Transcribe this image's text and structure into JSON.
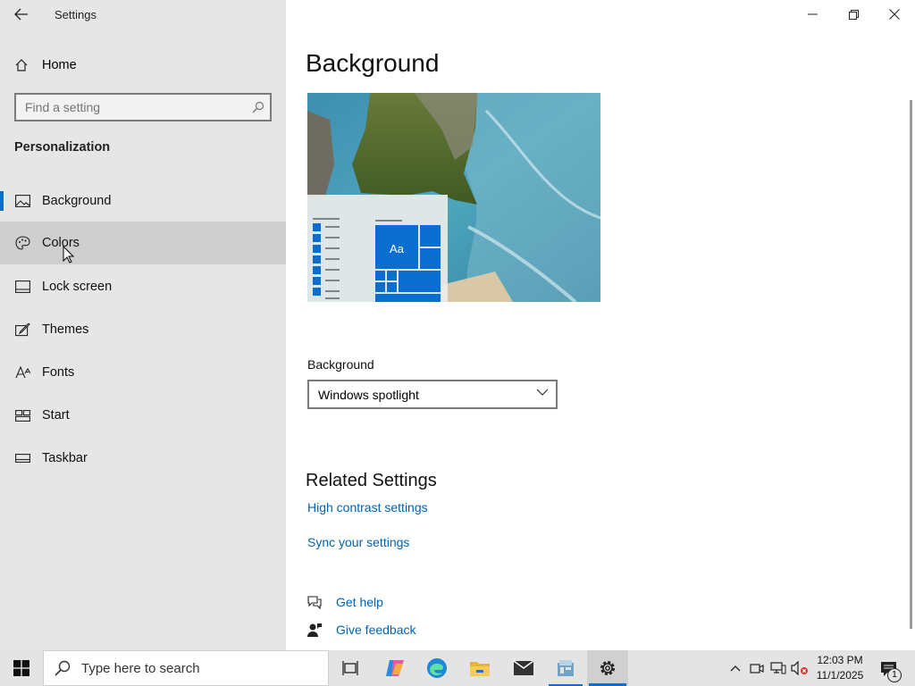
{
  "window": {
    "title": "Settings"
  },
  "sidebar": {
    "home_label": "Home",
    "search_placeholder": "Find a setting",
    "section": "Personalization",
    "items": [
      {
        "label": "Background",
        "icon": "picture-icon",
        "selected": true
      },
      {
        "label": "Colors",
        "icon": "palette-icon",
        "hover": true
      },
      {
        "label": "Lock screen",
        "icon": "lock-screen-icon"
      },
      {
        "label": "Themes",
        "icon": "brush-icon"
      },
      {
        "label": "Fonts",
        "icon": "font-icon"
      },
      {
        "label": "Start",
        "icon": "start-tiles-icon"
      },
      {
        "label": "Taskbar",
        "icon": "taskbar-icon"
      }
    ]
  },
  "main": {
    "title": "Background",
    "preview": {
      "tile_text": "Aa"
    },
    "background_label": "Background",
    "background_value": "Windows spotlight",
    "related_heading": "Related Settings",
    "links": [
      "High contrast settings",
      "Sync your settings"
    ],
    "help": {
      "get_help": "Get help",
      "give_feedback": "Give feedback"
    }
  },
  "taskbar": {
    "search_placeholder": "Type here to search",
    "time": "12:03 PM",
    "date": "11/1/2025",
    "notification_count": "1"
  },
  "colors": {
    "accent": "#0a6ed1",
    "link": "#0063b1",
    "sidebar_bg": "#e6e6e6",
    "hover_bg": "#cfcfcf"
  }
}
